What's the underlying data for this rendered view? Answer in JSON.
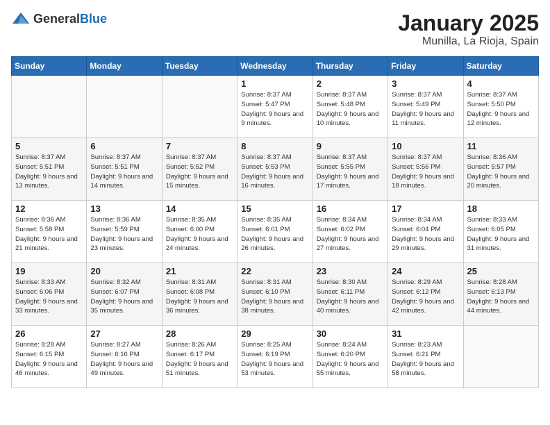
{
  "logo": {
    "general": "General",
    "blue": "Blue"
  },
  "header": {
    "month": "January 2025",
    "location": "Munilla, La Rioja, Spain"
  },
  "weekdays": [
    "Sunday",
    "Monday",
    "Tuesday",
    "Wednesday",
    "Thursday",
    "Friday",
    "Saturday"
  ],
  "weeks": [
    [
      {
        "day": "",
        "sunrise": "",
        "sunset": "",
        "daylight": ""
      },
      {
        "day": "",
        "sunrise": "",
        "sunset": "",
        "daylight": ""
      },
      {
        "day": "",
        "sunrise": "",
        "sunset": "",
        "daylight": ""
      },
      {
        "day": "1",
        "sunrise": "Sunrise: 8:37 AM",
        "sunset": "Sunset: 5:47 PM",
        "daylight": "Daylight: 9 hours and 9 minutes."
      },
      {
        "day": "2",
        "sunrise": "Sunrise: 8:37 AM",
        "sunset": "Sunset: 5:48 PM",
        "daylight": "Daylight: 9 hours and 10 minutes."
      },
      {
        "day": "3",
        "sunrise": "Sunrise: 8:37 AM",
        "sunset": "Sunset: 5:49 PM",
        "daylight": "Daylight: 9 hours and 11 minutes."
      },
      {
        "day": "4",
        "sunrise": "Sunrise: 8:37 AM",
        "sunset": "Sunset: 5:50 PM",
        "daylight": "Daylight: 9 hours and 12 minutes."
      }
    ],
    [
      {
        "day": "5",
        "sunrise": "Sunrise: 8:37 AM",
        "sunset": "Sunset: 5:51 PM",
        "daylight": "Daylight: 9 hours and 13 minutes."
      },
      {
        "day": "6",
        "sunrise": "Sunrise: 8:37 AM",
        "sunset": "Sunset: 5:51 PM",
        "daylight": "Daylight: 9 hours and 14 minutes."
      },
      {
        "day": "7",
        "sunrise": "Sunrise: 8:37 AM",
        "sunset": "Sunset: 5:52 PM",
        "daylight": "Daylight: 9 hours and 15 minutes."
      },
      {
        "day": "8",
        "sunrise": "Sunrise: 8:37 AM",
        "sunset": "Sunset: 5:53 PM",
        "daylight": "Daylight: 9 hours and 16 minutes."
      },
      {
        "day": "9",
        "sunrise": "Sunrise: 8:37 AM",
        "sunset": "Sunset: 5:55 PM",
        "daylight": "Daylight: 9 hours and 17 minutes."
      },
      {
        "day": "10",
        "sunrise": "Sunrise: 8:37 AM",
        "sunset": "Sunset: 5:56 PM",
        "daylight": "Daylight: 9 hours and 18 minutes."
      },
      {
        "day": "11",
        "sunrise": "Sunrise: 8:36 AM",
        "sunset": "Sunset: 5:57 PM",
        "daylight": "Daylight: 9 hours and 20 minutes."
      }
    ],
    [
      {
        "day": "12",
        "sunrise": "Sunrise: 8:36 AM",
        "sunset": "Sunset: 5:58 PM",
        "daylight": "Daylight: 9 hours and 21 minutes."
      },
      {
        "day": "13",
        "sunrise": "Sunrise: 8:36 AM",
        "sunset": "Sunset: 5:59 PM",
        "daylight": "Daylight: 9 hours and 23 minutes."
      },
      {
        "day": "14",
        "sunrise": "Sunrise: 8:35 AM",
        "sunset": "Sunset: 6:00 PM",
        "daylight": "Daylight: 9 hours and 24 minutes."
      },
      {
        "day": "15",
        "sunrise": "Sunrise: 8:35 AM",
        "sunset": "Sunset: 6:01 PM",
        "daylight": "Daylight: 9 hours and 26 minutes."
      },
      {
        "day": "16",
        "sunrise": "Sunrise: 8:34 AM",
        "sunset": "Sunset: 6:02 PM",
        "daylight": "Daylight: 9 hours and 27 minutes."
      },
      {
        "day": "17",
        "sunrise": "Sunrise: 8:34 AM",
        "sunset": "Sunset: 6:04 PM",
        "daylight": "Daylight: 9 hours and 29 minutes."
      },
      {
        "day": "18",
        "sunrise": "Sunrise: 8:33 AM",
        "sunset": "Sunset: 6:05 PM",
        "daylight": "Daylight: 9 hours and 31 minutes."
      }
    ],
    [
      {
        "day": "19",
        "sunrise": "Sunrise: 8:33 AM",
        "sunset": "Sunset: 6:06 PM",
        "daylight": "Daylight: 9 hours and 33 minutes."
      },
      {
        "day": "20",
        "sunrise": "Sunrise: 8:32 AM",
        "sunset": "Sunset: 6:07 PM",
        "daylight": "Daylight: 9 hours and 35 minutes."
      },
      {
        "day": "21",
        "sunrise": "Sunrise: 8:31 AM",
        "sunset": "Sunset: 6:08 PM",
        "daylight": "Daylight: 9 hours and 36 minutes."
      },
      {
        "day": "22",
        "sunrise": "Sunrise: 8:31 AM",
        "sunset": "Sunset: 6:10 PM",
        "daylight": "Daylight: 9 hours and 38 minutes."
      },
      {
        "day": "23",
        "sunrise": "Sunrise: 8:30 AM",
        "sunset": "Sunset: 6:11 PM",
        "daylight": "Daylight: 9 hours and 40 minutes."
      },
      {
        "day": "24",
        "sunrise": "Sunrise: 8:29 AM",
        "sunset": "Sunset: 6:12 PM",
        "daylight": "Daylight: 9 hours and 42 minutes."
      },
      {
        "day": "25",
        "sunrise": "Sunrise: 8:28 AM",
        "sunset": "Sunset: 6:13 PM",
        "daylight": "Daylight: 9 hours and 44 minutes."
      }
    ],
    [
      {
        "day": "26",
        "sunrise": "Sunrise: 8:28 AM",
        "sunset": "Sunset: 6:15 PM",
        "daylight": "Daylight: 9 hours and 46 minutes."
      },
      {
        "day": "27",
        "sunrise": "Sunrise: 8:27 AM",
        "sunset": "Sunset: 6:16 PM",
        "daylight": "Daylight: 9 hours and 49 minutes."
      },
      {
        "day": "28",
        "sunrise": "Sunrise: 8:26 AM",
        "sunset": "Sunset: 6:17 PM",
        "daylight": "Daylight: 9 hours and 51 minutes."
      },
      {
        "day": "29",
        "sunrise": "Sunrise: 8:25 AM",
        "sunset": "Sunset: 6:19 PM",
        "daylight": "Daylight: 9 hours and 53 minutes."
      },
      {
        "day": "30",
        "sunrise": "Sunrise: 8:24 AM",
        "sunset": "Sunset: 6:20 PM",
        "daylight": "Daylight: 9 hours and 55 minutes."
      },
      {
        "day": "31",
        "sunrise": "Sunrise: 8:23 AM",
        "sunset": "Sunset: 6:21 PM",
        "daylight": "Daylight: 9 hours and 58 minutes."
      },
      {
        "day": "",
        "sunrise": "",
        "sunset": "",
        "daylight": ""
      }
    ]
  ]
}
